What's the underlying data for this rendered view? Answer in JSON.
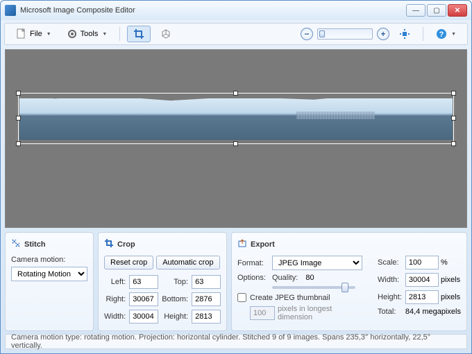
{
  "window": {
    "title": "Microsoft Image Composite Editor"
  },
  "toolbar": {
    "file": "File",
    "tools": "Tools"
  },
  "panels": {
    "stitch": {
      "title": "Stitch",
      "camera_label": "Camera motion:",
      "camera_value": "Rotating Motion"
    },
    "crop": {
      "title": "Crop",
      "reset": "Reset crop",
      "auto": "Automatic crop",
      "left_label": "Left:",
      "left": "63",
      "top_label": "Top:",
      "top": "63",
      "right_label": "Right:",
      "right": "30067",
      "bottom_label": "Bottom:",
      "bottom": "2876",
      "width_label": "Width:",
      "width": "30004",
      "height_label": "Height:",
      "height": "2813"
    },
    "export": {
      "title": "Export",
      "format_label": "Format:",
      "format_value": "JPEG Image",
      "options_label": "Options:",
      "quality_label": "Quality:",
      "quality_value": "80",
      "thumb_label": "Create JPEG thumbnail",
      "thumb_px": "100",
      "thumb_suffix": "pixels in longest dimension",
      "scale_label": "Scale:",
      "scale": "100",
      "scale_unit": "%",
      "width_label": "Width:",
      "width": "30004",
      "px": "pixels",
      "height_label": "Height:",
      "height": "2813",
      "total_label": "Total:",
      "total": "84,4 megapixels"
    }
  },
  "status": "Camera motion type: rotating motion. Projection: horizontal cylinder. Stitched 9 of 9 images. Spans 235,3° horizontally, 22,5° vertically."
}
